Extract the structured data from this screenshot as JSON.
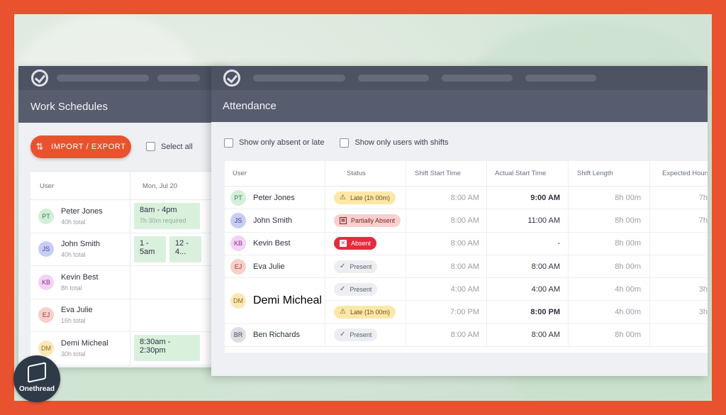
{
  "colors": {
    "accent": "#e8522e",
    "topbar": "#4d5363",
    "titlebar": "#575d6e",
    "shift_green": "#d9f0dd",
    "absent_red": "#e32c3d"
  },
  "schedules": {
    "title": "Work Schedules",
    "import_export_label": "IMPORT / EXPORT",
    "select_all_label": "Select all",
    "col_user": "User",
    "col_date": "Mon, Jul 20",
    "users": [
      {
        "initials": "PT",
        "name": "Peter Jones",
        "total": "40h total",
        "av_bg": "#d3efd9",
        "av_fg": "#3c7a4a",
        "shifts": [
          {
            "time": "8am - 4pm",
            "note": "7h 30m required"
          }
        ]
      },
      {
        "initials": "JS",
        "name": "John Smith",
        "total": "40h total",
        "av_bg": "#c9cdf4",
        "av_fg": "#3a3f8a",
        "shifts": [
          {
            "time": "1 - 5am"
          },
          {
            "time": "12 - 4..."
          }
        ]
      },
      {
        "initials": "KB",
        "name": "Kevin Best",
        "total": "8h total",
        "av_bg": "#f4d2f4",
        "av_fg": "#8a2e8a",
        "shifts": []
      },
      {
        "initials": "EJ",
        "name": "Eva Julie",
        "total": "16h total",
        "av_bg": "#f7d0cb",
        "av_fg": "#9a3a2e",
        "shifts": []
      },
      {
        "initials": "DM",
        "name": "Demi Micheal",
        "total": "30h total",
        "av_bg": "#fbe8b5",
        "av_fg": "#8a6a1a",
        "shifts": [
          {
            "time": "8:30am - 2:30pm"
          }
        ]
      }
    ]
  },
  "attendance": {
    "title": "Attendance",
    "filter_absent_late": "Show only absent or late",
    "filter_with_shifts": "Show only users with shifts",
    "columns": [
      "User",
      "Status",
      "Shift Start Time",
      "Actual Start Time",
      "Shift Length",
      "Expected Hours"
    ],
    "rows": [
      {
        "initials": "PT",
        "name": "Peter Jones",
        "status": "Late (1h 00m)",
        "status_type": "late",
        "shift_start": "8:00 AM",
        "actual_start": "9:00 AM",
        "actual_bold": true,
        "length": "8h 00m",
        "expected": "7h"
      },
      {
        "initials": "JS",
        "name": "John Smith",
        "status": "Partially Absent",
        "status_type": "partial",
        "shift_start": "8:00 AM",
        "actual_start": "11:00 AM",
        "actual_bold": false,
        "length": "8h 00m",
        "expected": "7h"
      },
      {
        "initials": "KB",
        "name": "Kevin Best",
        "status": "Absent",
        "status_type": "absent",
        "shift_start": "8:00 AM",
        "actual_start": "-",
        "actual_bold": false,
        "length": "8h 00m",
        "expected": ""
      },
      {
        "initials": "EJ",
        "name": "Eva Julie",
        "status": "Present",
        "status_type": "present",
        "shift_start": "8:00 AM",
        "actual_start": "8:00 AM",
        "actual_bold": false,
        "length": "8h 00m",
        "expected": ""
      },
      {
        "initials": "DM",
        "name": "Demi Micheal",
        "status": "Present",
        "status_type": "present",
        "shift_start": "4:00 AM",
        "actual_start": "4:00 AM",
        "actual_bold": false,
        "length": "4h 00m",
        "expected": "3h"
      },
      {
        "initials": "",
        "name": "",
        "status": "Late (1h 00m)",
        "status_type": "late",
        "shift_start": "7:00 PM",
        "actual_start": "8:00 PM",
        "actual_bold": true,
        "length": "4h 00m",
        "expected": "3h"
      },
      {
        "initials": "BR",
        "name": "Ben Richards",
        "status": "Present",
        "status_type": "present",
        "shift_start": "8:00 AM",
        "actual_start": "8:00 AM",
        "actual_bold": false,
        "length": "8h 00m",
        "expected": ""
      }
    ],
    "avatar_colors": {
      "PT": [
        "#d3efd9",
        "#3c7a4a"
      ],
      "JS": [
        "#c9cdf4",
        "#3a3f8a"
      ],
      "KB": [
        "#f4d2f4",
        "#8a2e8a"
      ],
      "EJ": [
        "#f7d0cb",
        "#9a3a2e"
      ],
      "DM": [
        "#fbe8b5",
        "#8a6a1a"
      ],
      "BR": [
        "#dcdee3",
        "#4a4f5c"
      ]
    }
  },
  "brand": {
    "name": "Onethread"
  }
}
